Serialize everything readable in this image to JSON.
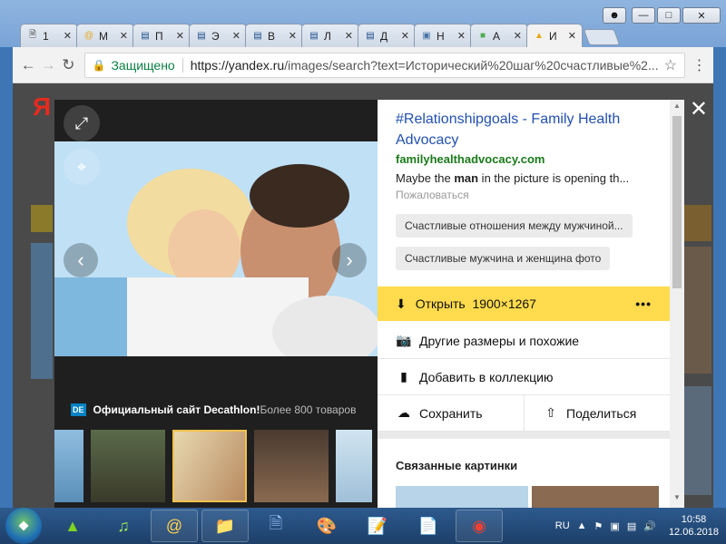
{
  "browser": {
    "tabs": [
      {
        "label": "1",
        "icon": "page-icon"
      },
      {
        "label": "M",
        "icon": "mail-at-icon"
      },
      {
        "label": "П",
        "icon": "doc-icon"
      },
      {
        "label": "Э",
        "icon": "doc-icon"
      },
      {
        "label": "В",
        "icon": "doc-icon"
      },
      {
        "label": "Л",
        "icon": "doc-icon"
      },
      {
        "label": "Д",
        "icon": "doc-icon"
      },
      {
        "label": "Н",
        "icon": "vk-icon"
      },
      {
        "label": "А",
        "icon": "green-square-icon"
      },
      {
        "label": "И",
        "icon": "image-icon",
        "active": true
      }
    ],
    "secure_label": "Защищено",
    "url_host": "https://yandex.ru",
    "url_path": "/images/search?text=Исторический%20шаг%20счастливые%2..."
  },
  "viewer": {
    "ad_text_bold": "Официальный сайт Decathlon!",
    "ad_text_rest": " Более 800 товаров",
    "ad_logo": "DE",
    "thumbnail_count": 5,
    "selected_thumbnail": 3
  },
  "panel": {
    "title": "#Relationshipgoals - Family Health Advocacy",
    "host": "familyhealthadvocacy.com",
    "desc_pre": "Maybe the ",
    "desc_bold": "man",
    "desc_post": " in the picture is opening th...",
    "complain": "Пожаловаться",
    "chips": [
      "Счастливые отношения между мужчиной...",
      "Счастливые мужчина и женщина фото"
    ],
    "open_label": "Открыть",
    "open_size": "1900×1267",
    "more_label": "•••",
    "other_sizes": "Другие размеры и похожие",
    "add_collection": "Добавить в коллекцию",
    "save": "Сохранить",
    "share": "Поделиться",
    "related_title": "Связанные картинки"
  },
  "taskbar": {
    "lang": "RU",
    "time": "10:58",
    "date": "12.06.2018"
  },
  "colors": {
    "accent_yellow": "#ffdb4d",
    "link_blue": "#2350b0",
    "host_green": "#1a7a1a"
  }
}
